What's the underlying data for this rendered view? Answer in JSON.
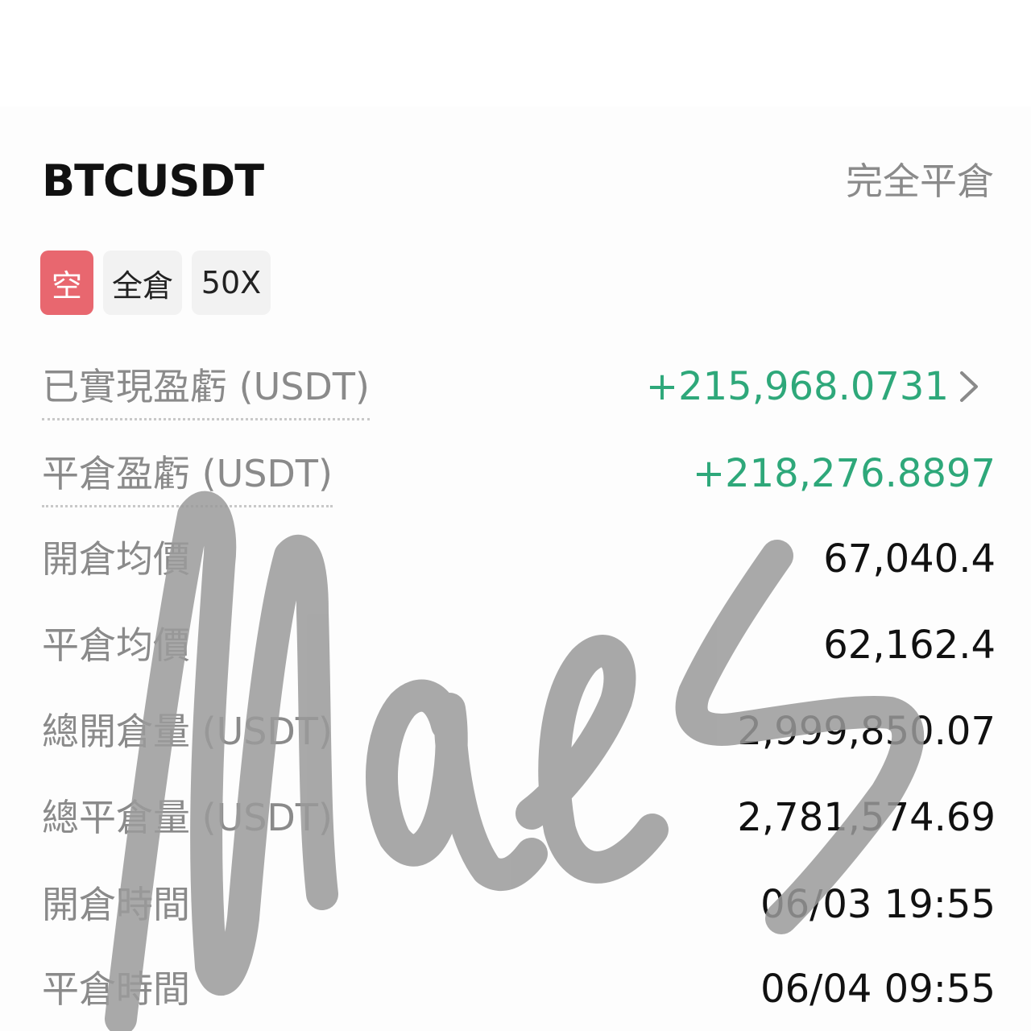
{
  "position": {
    "symbol": "BTCUSDT",
    "close_all_label": "完全平倉",
    "tags": {
      "side": "空",
      "margin_mode": "全倉",
      "leverage": "50X"
    }
  },
  "details": [
    {
      "label": "已實現盈虧 (USDT)",
      "value": "+215,968.0731",
      "color": "#2ea87a"
    },
    {
      "label": "平倉盈虧 (USDT)",
      "value": "+218,276.8897",
      "color": "#2ea87a"
    },
    {
      "label": "開倉均價",
      "value": "67,040.4"
    },
    {
      "label": "平倉均價",
      "value": "62,162.4"
    },
    {
      "label": "總開倉量 (USDT)",
      "value": "2,999,850.07"
    },
    {
      "label": "總平倉量 (USDT)",
      "value": "2,781,574.69"
    },
    {
      "label": "開倉時間",
      "value": "06/03 19:55"
    },
    {
      "label": "平倉時間",
      "value": "06/04 09:55"
    }
  ],
  "icons": {
    "realized_pnl_arrow": "chevron-right-icon"
  },
  "signature": {
    "text": "Mae S",
    "color": "#9a9a9a"
  },
  "colors": {
    "profit": "#2ea87a",
    "short_tag": "#e8676f",
    "label": "#8a8a8a",
    "value": "#111111"
  }
}
